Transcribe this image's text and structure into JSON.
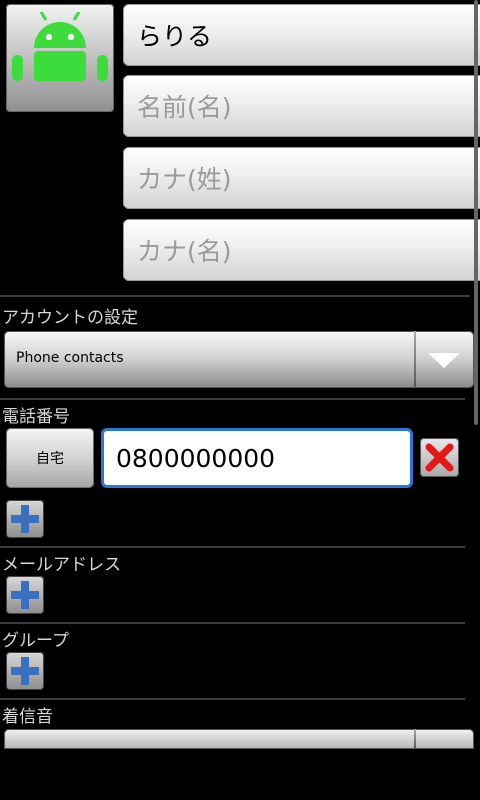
{
  "name_fields": {
    "family_name_value": "らりる",
    "given_name_placeholder": "名前(名)",
    "family_kana_placeholder": "カナ(姓)",
    "given_kana_placeholder": "カナ(名)"
  },
  "account": {
    "label": "アカウントの設定",
    "selected": "Phone contacts"
  },
  "phone": {
    "label": "電話番号",
    "type": "自宅",
    "value": "0800000000"
  },
  "email": {
    "label": "メールアドレス"
  },
  "group": {
    "label": "グループ"
  },
  "ringtone": {
    "label": "着信音"
  },
  "icons": {
    "photo": "android-robot-icon",
    "remove": "red-x-icon",
    "add": "blue-plus-icon",
    "dropdown": "triangle-down-icon"
  },
  "colors": {
    "android_green": "#3ddc3d",
    "focus_blue": "#2a78d6",
    "remove_red": "#e01818",
    "add_blue": "#3b6fc0"
  }
}
